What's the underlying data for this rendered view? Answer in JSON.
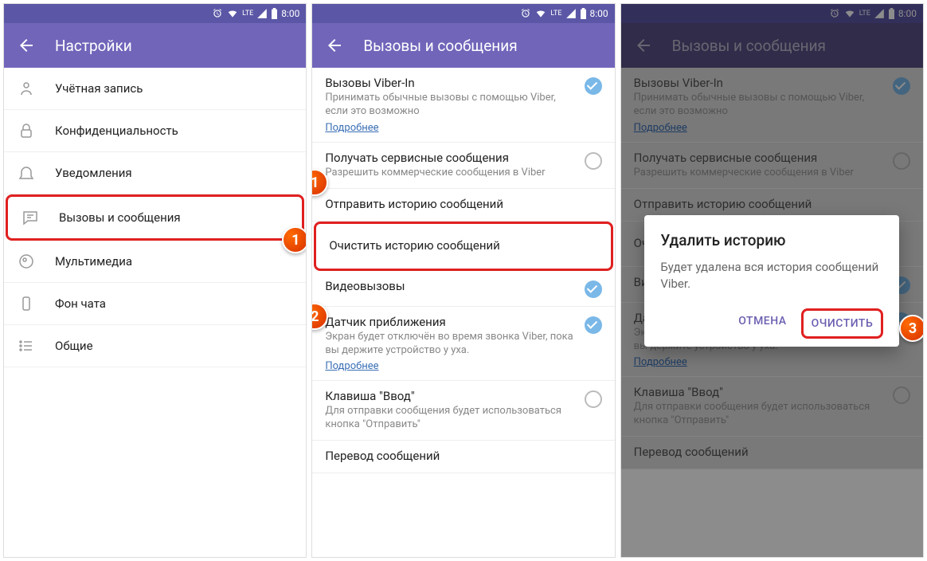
{
  "status": {
    "time": "8:00",
    "lte": "LTE"
  },
  "screen1": {
    "title": "Настройки",
    "items": [
      {
        "label": "Учётная запись"
      },
      {
        "label": "Конфиденциальность"
      },
      {
        "label": "Уведомления"
      },
      {
        "label": "Вызовы и сообщения"
      },
      {
        "label": "Мультимедиа"
      },
      {
        "label": "Фон чата"
      },
      {
        "label": "Общие"
      }
    ]
  },
  "screen2": {
    "title": "Вызовы и сообщения",
    "items": {
      "viberIn": {
        "title": "Вызовы Viber-In",
        "desc": "Принимать обычные вызовы с помощью Viber, если это возможно",
        "link": "Подробнее"
      },
      "service": {
        "title": "Получать сервисные сообщения",
        "desc": "Разрешить коммерческие сообщения в Viber"
      },
      "sendHistory": {
        "title": "Отправить историю сообщений"
      },
      "clearHistory": {
        "title": "Очистить историю сообщений"
      },
      "video": {
        "title": "Видеовызовы"
      },
      "proximity": {
        "title": "Датчик приближения",
        "desc": "Экран будет отключён во время звонка Viber, пока вы держите устройство у уха.",
        "link": "Подробнее"
      },
      "enterKey": {
        "title": "Клавиша \"Ввод\"",
        "desc": "Для отправки сообщения будет использоваться кнопка \"Отправить\""
      },
      "translate": {
        "title": "Перевод сообщений"
      }
    }
  },
  "dialog": {
    "title": "Удалить историю",
    "message": "Будет удалена вся история сообщений Viber.",
    "cancel": "ОТМЕНА",
    "confirm": "ОЧИСТИТЬ"
  },
  "steps": {
    "s1": "1",
    "s2": "2",
    "s3": "3"
  }
}
